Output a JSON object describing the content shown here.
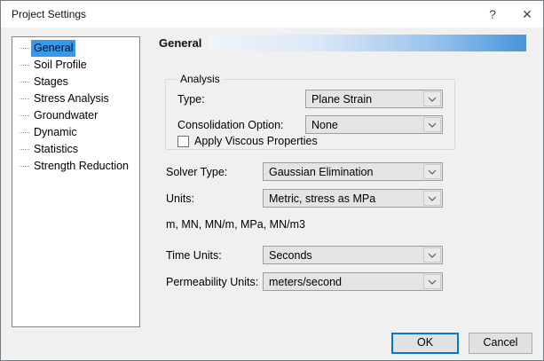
{
  "window": {
    "title": "Project Settings",
    "help_icon": "?",
    "close_icon": "✕"
  },
  "sidebar": {
    "items": [
      {
        "label": "General",
        "selected": true
      },
      {
        "label": "Soil Profile",
        "selected": false
      },
      {
        "label": "Stages",
        "selected": false
      },
      {
        "label": "Stress Analysis",
        "selected": false
      },
      {
        "label": "Groundwater",
        "selected": false
      },
      {
        "label": "Dynamic",
        "selected": false
      },
      {
        "label": "Statistics",
        "selected": false
      },
      {
        "label": "Strength Reduction",
        "selected": false
      }
    ]
  },
  "header": {
    "title": "General"
  },
  "analysis_group": {
    "title": "Analysis",
    "type_label": "Type:",
    "type_value": "Plane Strain",
    "consolidation_label": "Consolidation Option:",
    "consolidation_value": "None",
    "viscous_label": "Apply Viscous Properties",
    "viscous_checked": false
  },
  "fields": {
    "solver_label": "Solver Type:",
    "solver_value": "Gaussian Elimination",
    "units_label": "Units:",
    "units_value": "Metric, stress as MPa",
    "units_description": "m, MN, MN/m, MPa, MN/m3",
    "time_label": "Time Units:",
    "time_value": "Seconds",
    "permeability_label": "Permeability Units:",
    "permeability_value": "meters/second"
  },
  "footer": {
    "ok_label": "OK",
    "cancel_label": "Cancel"
  },
  "colors": {
    "dialog_background": "#f0f0f0",
    "titlebar_background": "#ffffff",
    "tree_selection": "#3799ec",
    "header_gradient_end": "#4695dc",
    "combo_background": "#e4e4e4",
    "default_button_border": "#0078d7"
  }
}
